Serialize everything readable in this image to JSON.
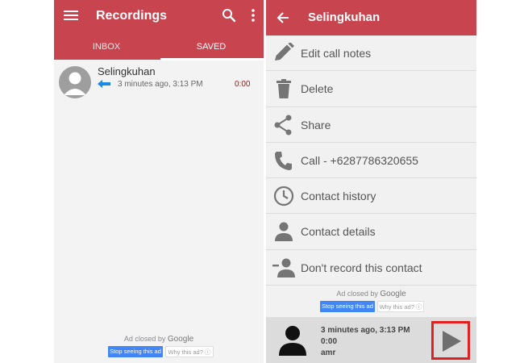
{
  "left": {
    "title": "Recordings",
    "tabs": [
      {
        "label": "INBOX"
      },
      {
        "label": "SAVED"
      }
    ],
    "recording": {
      "name": "Selingkuhan",
      "time": "3 minutes ago, 3:13 PM",
      "duration": "0:00"
    },
    "ad": {
      "closed_by": "Ad closed by",
      "brand": "Google",
      "stop_label": "Stop seeing this ad",
      "why_label": "Why this ad? ⓘ"
    }
  },
  "right": {
    "title": "Selingkuhan",
    "menu": [
      {
        "label": "Edit call notes",
        "icon": "pencil-icon"
      },
      {
        "label": "Delete",
        "icon": "trash-icon"
      },
      {
        "label": "Share",
        "icon": "share-icon"
      },
      {
        "label": "Call - +6287786320655",
        "icon": "phone-icon"
      },
      {
        "label": "Contact history",
        "icon": "clock-icon"
      },
      {
        "label": "Contact details",
        "icon": "person-icon"
      },
      {
        "label": "Don't record this contact",
        "icon": "person-remove-icon"
      }
    ],
    "ad": {
      "closed_by": "Ad closed by",
      "brand": "Google",
      "stop_label": "Stop seeing this ad",
      "why_label": "Why this ad? ⓘ"
    },
    "player": {
      "time": "3 minutes ago, 3:13 PM",
      "duration": "0:00",
      "user": "amr"
    }
  },
  "colors": {
    "appbar": "#c8444e",
    "duration_text": "#8b1c1c",
    "incoming_arrow": "#1e88e5",
    "highlight_box": "#e02020",
    "ad_button": "#4285f4"
  }
}
